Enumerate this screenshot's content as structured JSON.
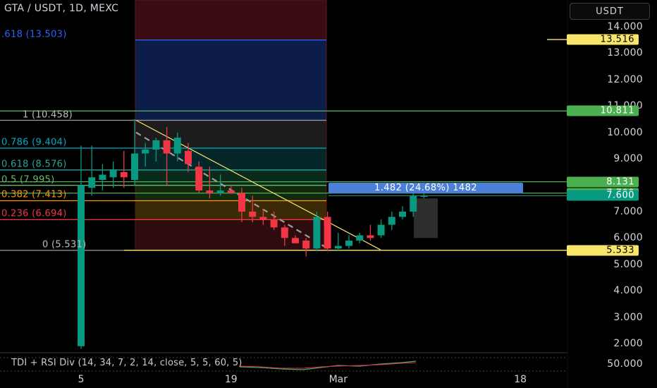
{
  "header": {
    "title": "GTA / USDT, 1D, MEXC",
    "currency_button": "USDT"
  },
  "indicator": {
    "label": "TDI + RSI Div (14, 34, 7, 2, 14, close, 5, 5, 60, 5)"
  },
  "price_axis": {
    "ticks": [
      {
        "label": "14.000",
        "value": 14.0
      },
      {
        "label": "13.000",
        "value": 13.0
      },
      {
        "label": "12.000",
        "value": 12.0
      },
      {
        "label": "11.000",
        "value": 11.0
      },
      {
        "label": "10.000",
        "value": 10.0
      },
      {
        "label": "9.000",
        "value": 9.0
      },
      {
        "label": "7.000",
        "value": 7.0
      },
      {
        "label": "6.000",
        "value": 6.0
      },
      {
        "label": "5.000",
        "value": 5.0
      },
      {
        "label": "4.000",
        "value": 4.0
      },
      {
        "label": "3.000",
        "value": 3.0
      },
      {
        "label": "2.000",
        "value": 2.0
      }
    ],
    "indicator_tick": "50.000"
  },
  "time_axis": {
    "ticks": [
      {
        "label": "5",
        "day": 0
      },
      {
        "label": "19",
        "day": 14
      },
      {
        "label": "Mar",
        "day": 24
      },
      {
        "label": "18",
        "day": 41
      }
    ]
  },
  "price_labels": [
    {
      "label": "13.516",
      "value": 13.516,
      "bg": "#f7e66b",
      "fg": "#000000"
    },
    {
      "label": "10.811",
      "value": 10.811,
      "bg": "#4caf50",
      "fg": "#ffffff"
    },
    {
      "label": "8.131",
      "value": 8.131,
      "bg": "#4caf50",
      "fg": "#ffffff"
    },
    {
      "label": "7.700",
      "value": 7.7,
      "bg": "#4caf50",
      "fg": "#ffffff"
    },
    {
      "label": "7.600",
      "value": 7.6,
      "bg": "#089981",
      "fg": "#ffffff"
    },
    {
      "label": "5.533",
      "value": 5.533,
      "bg": "#f7e66b",
      "fg": "#000000"
    }
  ],
  "fib_levels": [
    {
      "text": ".618 (13.503)",
      "price": 13.503,
      "color": "#2962ff"
    },
    {
      "text": "1 (10.458)",
      "price": 10.458,
      "color": "#9e9e9e"
    },
    {
      "text": "0.786 (9.404)",
      "price": 9.404,
      "color": "#00acc1"
    },
    {
      "text": "0.618 (8.576)",
      "price": 8.576,
      "color": "#26a69a"
    },
    {
      "text": "0.5 (7.995)",
      "price": 7.995,
      "color": "#66bb6a"
    },
    {
      "text": "0.382 (7.413)",
      "price": 7.413,
      "color": "#ff9800"
    },
    {
      "text": "0.236 (6.694)",
      "price": 6.694,
      "color": "#f23645"
    },
    {
      "text": "0 (5.531)",
      "price": 5.531,
      "color": "#9e9e9e"
    }
  ],
  "measure_label": "1.482 (24.68%) 1482",
  "colors": {
    "up": "#089981",
    "down": "#f23645",
    "trendline": "#f7e66b",
    "hline": "#4caf50",
    "bg": "#000000"
  },
  "chart_data": {
    "type": "candlestick",
    "title": "GTA / USDT, 1D, MEXC",
    "ylim": [
      1.6,
      14.6
    ],
    "candles": [
      {
        "day": 0,
        "o": 1.9,
        "h": 9.5,
        "l": 1.8,
        "c": 8.0
      },
      {
        "day": 1,
        "o": 7.9,
        "h": 9.5,
        "l": 7.6,
        "c": 8.3
      },
      {
        "day": 2,
        "o": 8.2,
        "h": 8.8,
        "l": 7.8,
        "c": 8.4
      },
      {
        "day": 3,
        "o": 8.3,
        "h": 8.9,
        "l": 7.9,
        "c": 8.6
      },
      {
        "day": 4,
        "o": 8.5,
        "h": 9.3,
        "l": 7.9,
        "c": 8.3
      },
      {
        "day": 5,
        "o": 8.2,
        "h": 10.5,
        "l": 8.0,
        "c": 9.2
      },
      {
        "day": 6,
        "o": 9.2,
        "h": 9.6,
        "l": 8.7,
        "c": 9.35
      },
      {
        "day": 7,
        "o": 9.35,
        "h": 9.8,
        "l": 8.9,
        "c": 9.7
      },
      {
        "day": 8,
        "o": 9.7,
        "h": 10.2,
        "l": 8.0,
        "c": 9.2
      },
      {
        "day": 9,
        "o": 9.2,
        "h": 10.0,
        "l": 8.9,
        "c": 9.8
      },
      {
        "day": 10,
        "o": 9.3,
        "h": 9.6,
        "l": 8.5,
        "c": 8.8
      },
      {
        "day": 11,
        "o": 8.7,
        "h": 8.9,
        "l": 7.7,
        "c": 7.8
      },
      {
        "day": 12,
        "o": 7.8,
        "h": 8.7,
        "l": 7.5,
        "c": 7.7
      },
      {
        "day": 13,
        "o": 7.7,
        "h": 8.4,
        "l": 7.6,
        "c": 7.8
      },
      {
        "day": 14,
        "o": 7.8,
        "h": 8.0,
        "l": 7.7,
        "c": 7.7
      },
      {
        "day": 15,
        "o": 7.7,
        "h": 7.9,
        "l": 6.6,
        "c": 7.0
      },
      {
        "day": 16,
        "o": 7.0,
        "h": 7.6,
        "l": 6.6,
        "c": 6.8
      },
      {
        "day": 17,
        "o": 6.8,
        "h": 7.1,
        "l": 6.5,
        "c": 6.7
      },
      {
        "day": 18,
        "o": 6.7,
        "h": 7.0,
        "l": 6.3,
        "c": 6.4
      },
      {
        "day": 19,
        "o": 6.4,
        "h": 6.5,
        "l": 5.7,
        "c": 6.0
      },
      {
        "day": 20,
        "o": 6.0,
        "h": 6.1,
        "l": 5.8,
        "c": 5.8
      },
      {
        "day": 21,
        "o": 5.9,
        "h": 6.0,
        "l": 5.3,
        "c": 5.6
      },
      {
        "day": 22,
        "o": 5.6,
        "h": 7.0,
        "l": 5.5,
        "c": 6.8
      },
      {
        "day": 23,
        "o": 6.8,
        "h": 7.0,
        "l": 5.5,
        "c": 5.6
      },
      {
        "day": 24,
        "o": 5.6,
        "h": 6.2,
        "l": 5.5,
        "c": 5.7
      },
      {
        "day": 25,
        "o": 5.7,
        "h": 6.1,
        "l": 5.6,
        "c": 5.9
      },
      {
        "day": 26,
        "o": 5.9,
        "h": 6.2,
        "l": 5.8,
        "c": 6.1
      },
      {
        "day": 27,
        "o": 6.1,
        "h": 6.5,
        "l": 5.9,
        "c": 6.0
      },
      {
        "day": 28,
        "o": 6.1,
        "h": 6.7,
        "l": 6.0,
        "c": 6.5
      },
      {
        "day": 29,
        "o": 6.5,
        "h": 7.0,
        "l": 6.3,
        "c": 6.8
      },
      {
        "day": 30,
        "o": 6.8,
        "h": 7.2,
        "l": 6.7,
        "c": 7.0
      },
      {
        "day": 31,
        "o": 7.0,
        "h": 7.7,
        "l": 6.8,
        "c": 7.6
      },
      {
        "day": 32,
        "o": 7.6,
        "h": 7.7,
        "l": 7.5,
        "c": 7.6
      }
    ]
  }
}
